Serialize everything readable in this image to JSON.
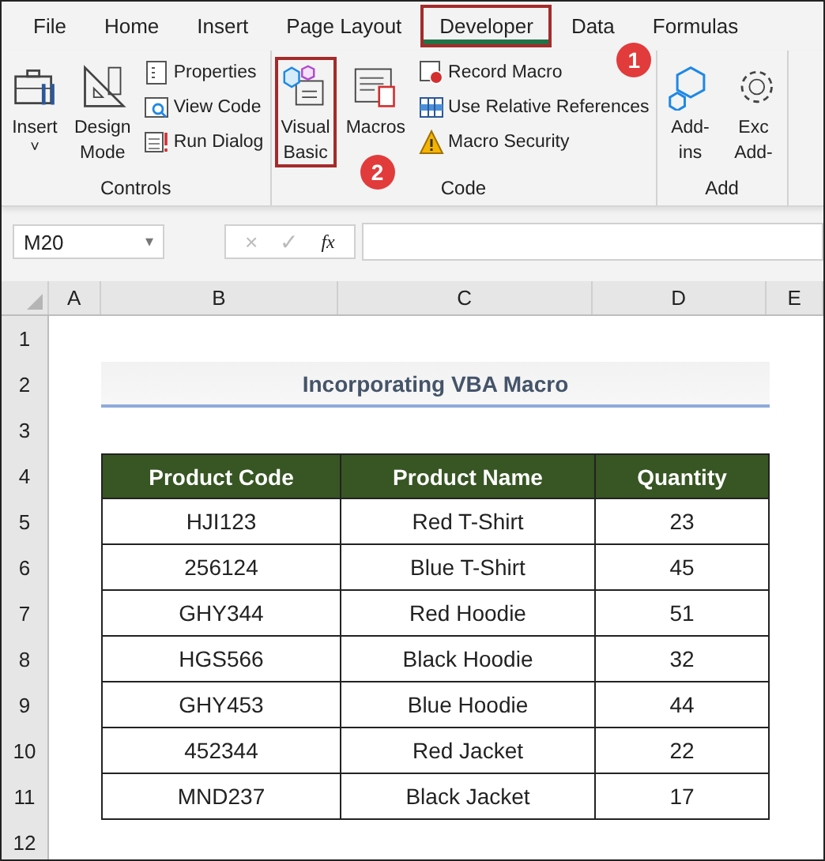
{
  "menu_tabs": [
    {
      "label": "File",
      "selected": false,
      "marked": false
    },
    {
      "label": "Home",
      "selected": false,
      "marked": false
    },
    {
      "label": "Insert",
      "selected": false,
      "marked": false
    },
    {
      "label": "Page Layout",
      "selected": false,
      "marked": false
    },
    {
      "label": "Developer",
      "selected": true,
      "marked": true,
      "callout": "1"
    },
    {
      "label": "Data",
      "selected": false,
      "marked": false
    },
    {
      "label": "Formulas",
      "selected": false,
      "marked": false
    }
  ],
  "ribbon_groups": [
    {
      "label": "Controls",
      "items": [
        {
          "kind": "large",
          "label": "Insert",
          "dropdown": "˅",
          "marked": false
        },
        {
          "kind": "large",
          "label": "Design\nMode",
          "marked": false
        },
        {
          "kind": "stack",
          "entries": [
            "Properties",
            "View Code",
            "Run Dialog"
          ]
        }
      ]
    },
    {
      "label": "Code",
      "items": [
        {
          "kind": "large",
          "label": "Visual\nBasic",
          "marked": true,
          "callout": "2"
        },
        {
          "kind": "large",
          "label": "Macros",
          "marked": false
        },
        {
          "kind": "stack",
          "entries": [
            "Record Macro",
            "Use Relative References",
            "Macro Security"
          ]
        }
      ]
    },
    {
      "label": "Add",
      "items": [
        {
          "kind": "large",
          "label": "Add-\nins",
          "marked": false
        },
        {
          "kind": "large",
          "label": "Exc\nAdd-",
          "marked": false
        }
      ]
    }
  ],
  "formula_bar": {
    "name_box": "M20",
    "dropdown": "▾",
    "cancel": "×",
    "enter": "✓",
    "function": "fx"
  },
  "sheet": {
    "columns": [
      "A",
      "B",
      "C",
      "D",
      "E"
    ],
    "row_numbers": [
      "1",
      "2",
      "3",
      "4",
      "5",
      "6",
      "7",
      "8",
      "9",
      "10",
      "11",
      "12"
    ],
    "title": "Incorporating VBA Macro",
    "table": {
      "columns": [
        "Product Code",
        "Product Name",
        "Quantity"
      ],
      "rows": [
        [
          "HJI123",
          "Red T-Shirt",
          "23"
        ],
        [
          "256124",
          "Blue T-Shirt",
          "45"
        ],
        [
          "GHY344",
          "Red Hoodie",
          "51"
        ],
        [
          "HGS566",
          "Black Hoodie",
          "32"
        ],
        [
          "GHY453",
          "Blue Hoodie",
          "44"
        ],
        [
          "452344",
          "Red Jacket",
          "22"
        ],
        [
          "MND237",
          "Black Jacket",
          "17"
        ]
      ]
    }
  }
}
